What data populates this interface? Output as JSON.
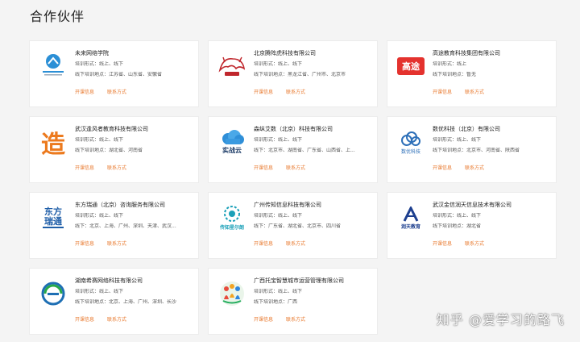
{
  "section_title": "合作伙伴",
  "watermark": "知乎 @爱学习的路飞",
  "partners": [
    {
      "name": "未来网络学院",
      "line1": "培训形式：线上、线下",
      "line2": "线下培训地点：江苏省、山东省、安徽省",
      "action1": "开课信息",
      "action2": "联系方式",
      "logo_icon": "future-network-academy-logo-icon"
    },
    {
      "name": "北京腾阵虎科技有限公司",
      "line1": "培训形式：线上、线下",
      "line2": "线下培训地点：黑龙江省、广州市、北京市",
      "action1": "开课信息",
      "action2": "联系方式",
      "logo_icon": "tiger-logo-icon"
    },
    {
      "name": "高途教育科技集团有限公司",
      "line1": "培训形式：线上",
      "line2": "线下培训地点：暂无",
      "action1": "开课信息",
      "action2": "联系方式",
      "logo_icon": "gaotu-logo-icon",
      "logo_text": "高途"
    },
    {
      "name": "武汉逢风者教育科技有限公司",
      "line1": "培训形式：线上、线下",
      "line2": "线下培训地点：湖北省、河南省",
      "action1": "开课信息",
      "action2": "联系方式",
      "logo_icon": "orange-logo-icon",
      "logo_text": "造"
    },
    {
      "name": "森纵艾数（北京）科技有限公司",
      "line1": "培训形式：线上、线下",
      "line2": "线下：北京市、湖南省、广东省、山西省、上...",
      "action1": "开课信息",
      "action2": "联系方式",
      "logo_icon": "cloud-logo-icon",
      "logo_text": "实战云"
    },
    {
      "name": "数优科技（北京）有限公司",
      "line1": "培训形式：线上、线下",
      "line2": "线下培训地点：北京市、河南省、陕西省",
      "action1": "开课信息",
      "action2": "联系方式",
      "logo_icon": "shuyou-logo-icon",
      "logo_text": "数优科技"
    },
    {
      "name": "东方瑞通（北京）咨询服务有限公司",
      "line1": "培训形式：线上、线下",
      "line2": "线下：北京、上海、广州、深圳、天津、武汉...",
      "action1": "开课信息",
      "action2": "联系方式",
      "logo_icon": "dongfang-logo-icon",
      "logo_text": "东方瑞通"
    },
    {
      "name": "广州传知信息科技有限公司",
      "line1": "培训形式：线上、线下",
      "line2": "线下：广东省、湖北省、北京市、四川省",
      "action1": "开课信息",
      "action2": "联系方式",
      "logo_icon": "chuanzhi-logo-icon",
      "logo_text": "传知星尔朗"
    },
    {
      "name": "武汉金信润天信息技术有限公司",
      "line1": "培训形式：线上、线下",
      "line2": "线下培训地点：湖北省",
      "action1": "开课信息",
      "action2": "联系方式",
      "logo_icon": "runtian-logo-icon",
      "logo_text": "润天教育"
    },
    {
      "name": "湖南希赛网络科技有限公司",
      "line1": "培训形式：线上、线下",
      "line2": "线下培训地点：北京、上海、广州、深圳、长沙",
      "action1": "开课信息",
      "action2": "联系方式",
      "logo_icon": "xisai-logo-icon"
    },
    {
      "name": "广西托宝智慧城市运营管理有限公司",
      "line1": "培训形式：线上、线下",
      "line2": "线下培训地点：广西",
      "action1": "开课信息",
      "action2": "联系方式",
      "logo_icon": "people-logo-icon"
    }
  ]
}
